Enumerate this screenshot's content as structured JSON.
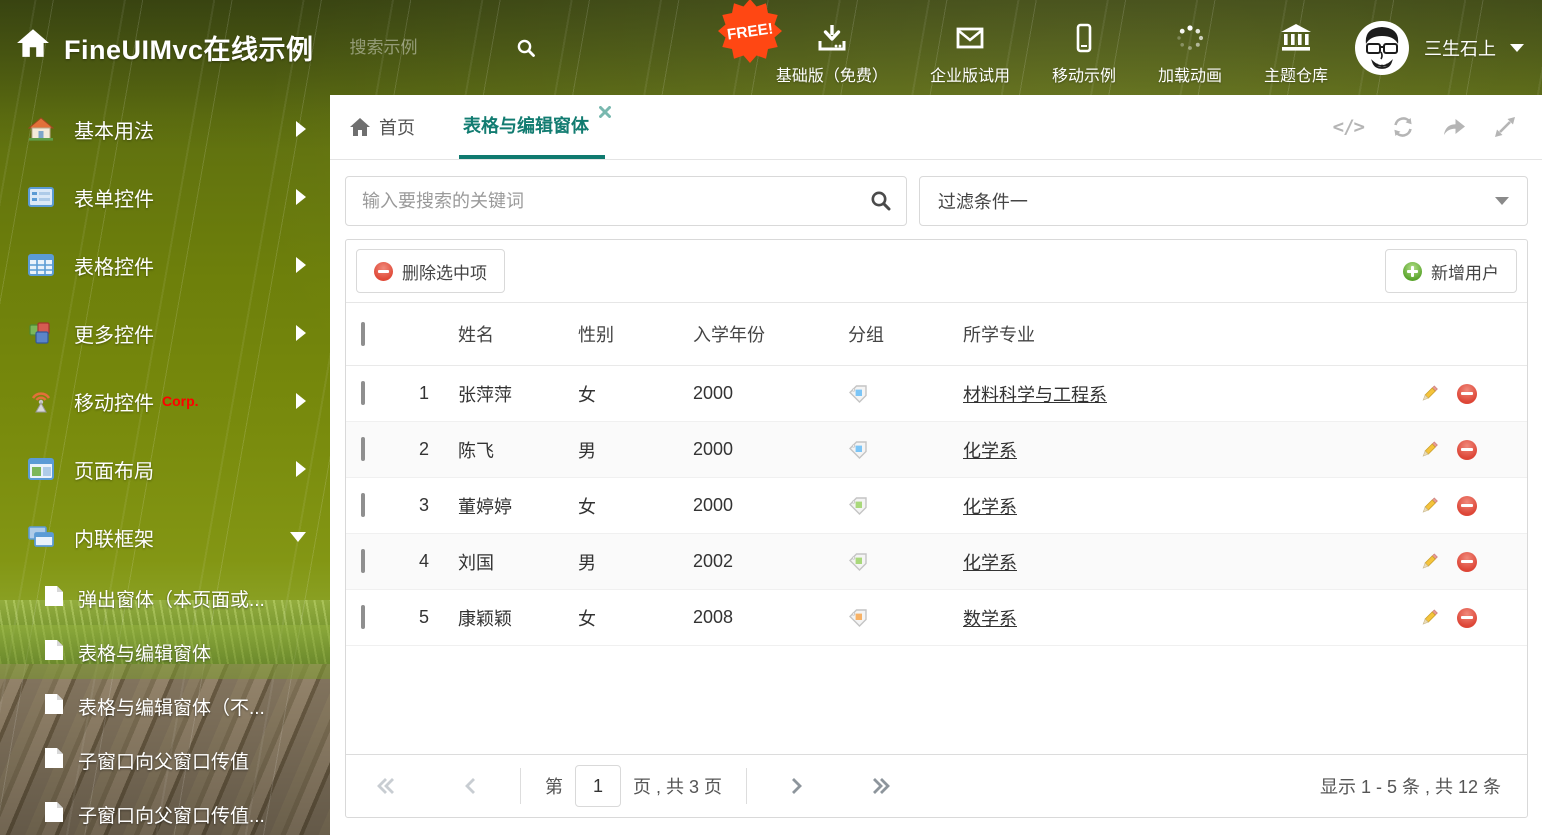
{
  "header": {
    "title": "FineUIMvc在线示例",
    "search_placeholder": "搜索示例",
    "free_badge": "FREE!",
    "nav": [
      {
        "label": "基础版（免费）",
        "icon": "download-icon"
      },
      {
        "label": "企业版试用",
        "icon": "envelope-icon"
      },
      {
        "label": "移动示例",
        "icon": "mobile-icon"
      },
      {
        "label": "加载动画",
        "icon": "spinner-icon"
      },
      {
        "label": "主题仓库",
        "icon": "bank-icon"
      }
    ],
    "username": "三生石上"
  },
  "sidebar": {
    "items": [
      {
        "label": "基本用法",
        "icon": "house-icon"
      },
      {
        "label": "表单控件",
        "icon": "form-icon"
      },
      {
        "label": "表格控件",
        "icon": "table-icon"
      },
      {
        "label": "更多控件",
        "icon": "cubes-icon"
      },
      {
        "label": "移动控件",
        "icon": "antenna-icon",
        "badge": "Corp."
      },
      {
        "label": "页面布局",
        "icon": "layout-icon"
      },
      {
        "label": "内联框架",
        "icon": "frames-icon",
        "expanded": true
      }
    ],
    "subitems": [
      {
        "label": "弹出窗体（本页面或..."
      },
      {
        "label": "表格与编辑窗体",
        "selected": true
      },
      {
        "label": "表格与编辑窗体（不..."
      },
      {
        "label": "子窗口向父窗口传值"
      },
      {
        "label": "子窗口向父窗口传值..."
      }
    ]
  },
  "tabs": {
    "home": "首页",
    "active": "表格与编辑窗体"
  },
  "icons": {
    "code_label": "</>"
  },
  "toolbar": {
    "search_placeholder": "输入要搜索的关键词",
    "filter_value": "过滤条件一",
    "delete_button": "删除选中项",
    "add_button": "新增用户"
  },
  "table": {
    "columns": {
      "name": "姓名",
      "gender": "性别",
      "year": "入学年份",
      "group": "分组",
      "major": "所学专业"
    },
    "rows": [
      {
        "index": "1",
        "name": "张萍萍",
        "gender": "女",
        "year": "2000",
        "tag_color": "#7cc5f6",
        "major": "材料科学与工程系"
      },
      {
        "index": "2",
        "name": "陈飞",
        "gender": "男",
        "year": "2000",
        "tag_color": "#7cc5f6",
        "major": "化学系"
      },
      {
        "index": "3",
        "name": "董婷婷",
        "gender": "女",
        "year": "2000",
        "tag_color": "#a9d87b",
        "major": "化学系"
      },
      {
        "index": "4",
        "name": "刘国",
        "gender": "男",
        "year": "2002",
        "tag_color": "#a9d87b",
        "major": "化学系"
      },
      {
        "index": "5",
        "name": "康颖颖",
        "gender": "女",
        "year": "2008",
        "tag_color": "#f7b267",
        "major": "数学系"
      }
    ]
  },
  "pagination": {
    "prefix": "第",
    "page_value": "1",
    "suffix": "页 , 共 3 页",
    "summary": "显示 1 - 5 条 , 共 12 条"
  },
  "colors": {
    "accent": "#127c71",
    "corp_red": "#ff0000"
  }
}
